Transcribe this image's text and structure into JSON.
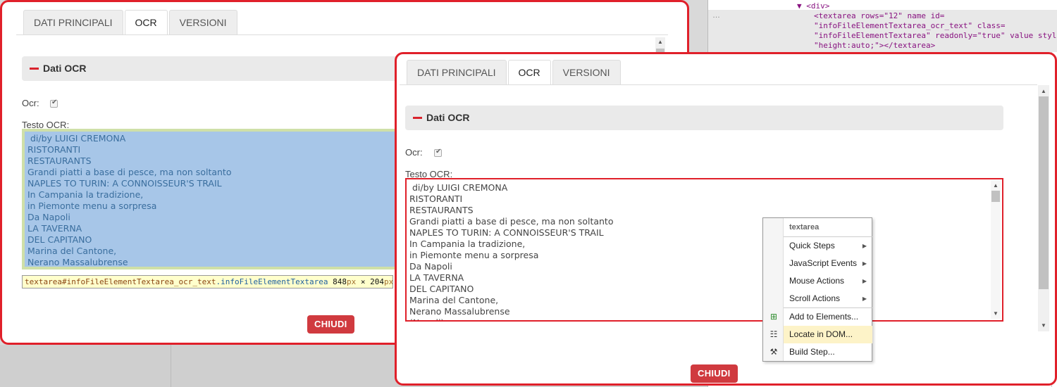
{
  "devtools": {
    "lines": [
      "▼ <div>",
      "<textarea rows=\"12\" name id=",
      "\"infoFileElementTextarea_ocr_text\" class=",
      "\"infoFileElementTextarea\" readonly=\"true\" value style",
      "\"height:auto;\"></textarea>"
    ],
    "dots": "…"
  },
  "tabs": [
    "DATI PRINCIPALI",
    "OCR",
    "VERSIONI"
  ],
  "panel": {
    "title": "Dati OCR",
    "ocr_label": "Ocr:",
    "text_label": "Testo OCR:"
  },
  "ocr_text_1": " di/by LUIGI CREMONA\nRISTORANTI\nRESTAURANTS\nGrandi piatti a base di pesce, ma non soltanto\nNAPLES TO TURIN: A CONNOISSEUR'S TRAIL\nIn Campania la tradizione,\nin Piemonte menu a sorpresa\nDa Napoli\nLA TAVERNA\nDEL CAPITANO\nMarina del Cantone,\nNerano Massalubrense\n(Napoli)",
  "ocr_text_2": " di/by LUIGI CREMONA\nRISTORANTI\nRESTAURANTS\nGrandi piatti a base di pesce, ma non soltanto\nNAPLES TO TURIN: A CONNOISSEUR'S TRAIL\nIn Campania la tradizione,\nin Piemonte menu a sorpresa\nDa Napoli\nLA TAVERNA\nDEL CAPITANO\nMarina del Cantone,\nNerano Massalubrense\n(Napoli)",
  "tooltip": {
    "tag": "textarea#infoFileElementTextarea_ocr_text",
    "cls": ".infoFileElementTextarea",
    "w": "848",
    "px1": "px",
    "times": " × ",
    "h": "204",
    "px2": "px"
  },
  "close_label": "CHIUDI",
  "context_menu": {
    "header": "textarea",
    "items": [
      "Quick Steps",
      "JavaScript Events",
      "Mouse Actions",
      "Scroll Actions"
    ],
    "actions": [
      "Add to Elements...",
      "Locate in DOM...",
      "Build Step..."
    ]
  }
}
